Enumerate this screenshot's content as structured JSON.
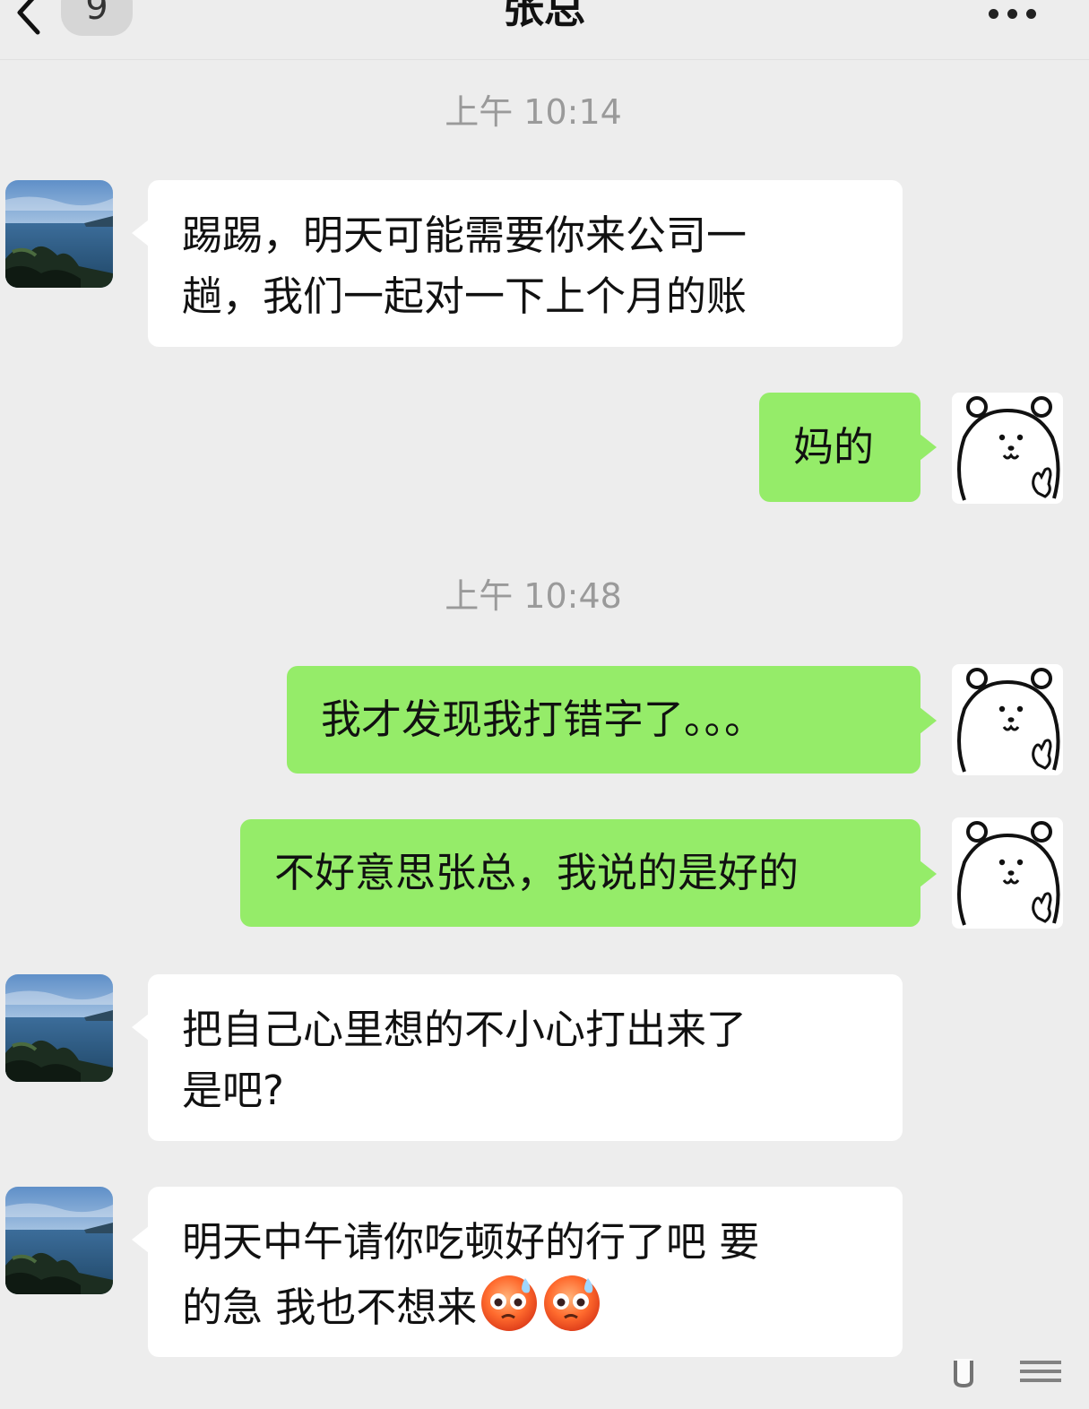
{
  "header": {
    "back_icon": "chevron-left-icon",
    "unread_count": "9",
    "title": "张总",
    "more_icon": "ellipsis-icon"
  },
  "colors": {
    "background": "#ededed",
    "incoming_bubble": "#ffffff",
    "outgoing_bubble": "#95ec69",
    "timestamp_text": "#9a9a9a"
  },
  "messages": [
    {
      "type": "timestamp",
      "text": "上午 10:14"
    },
    {
      "type": "incoming",
      "avatar": "landscape-avatar",
      "lines": [
        "踢踢，明天可能需要你来公司一",
        "趟，我们一起对一下上个月的账"
      ]
    },
    {
      "type": "outgoing",
      "avatar": "bear-avatar",
      "lines": [
        "妈的"
      ]
    },
    {
      "type": "timestamp",
      "text": "上午 10:48"
    },
    {
      "type": "outgoing",
      "avatar": "bear-avatar",
      "lines": [
        "我才发现我打错字了。。。"
      ]
    },
    {
      "type": "outgoing",
      "avatar": "bear-avatar",
      "lines": [
        "不好意思张总，我说的是好的"
      ]
    },
    {
      "type": "incoming",
      "avatar": "landscape-avatar",
      "lines": [
        "把自己心里想的不小心打出来了",
        "是吧?"
      ]
    },
    {
      "type": "incoming",
      "avatar": "landscape-avatar",
      "lines": [
        "明天中午请你吃顿好的行了吧 要",
        "的急 我也不想来"
      ],
      "emojis": [
        "sweat-face-emoji",
        "sweat-face-emoji"
      ]
    }
  ]
}
